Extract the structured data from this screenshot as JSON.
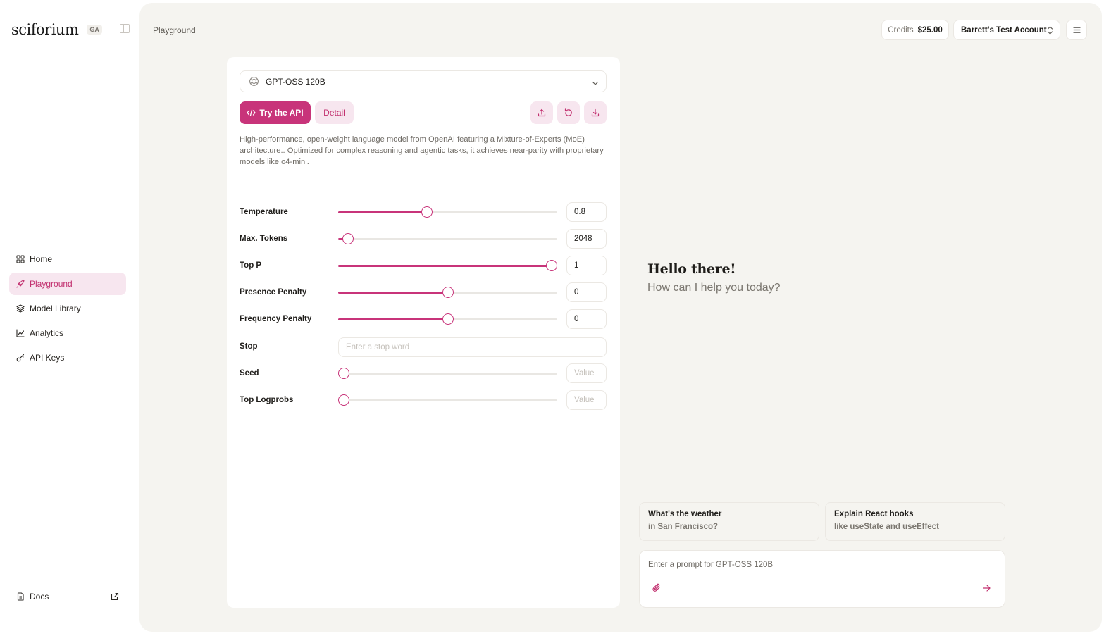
{
  "sidebar": {
    "logo": "sciforium",
    "badge": "GA",
    "items": [
      {
        "label": "Home",
        "icon": "grid-icon"
      },
      {
        "label": "Playground",
        "icon": "rocket-icon",
        "active": true
      },
      {
        "label": "Model Library",
        "icon": "layers-icon"
      },
      {
        "label": "Analytics",
        "icon": "chart-line-icon"
      },
      {
        "label": "API Keys",
        "icon": "key-icon"
      }
    ],
    "docs_label": "Docs"
  },
  "header": {
    "breadcrumb": "Playground",
    "credits_label": "Credits",
    "credits_amount": "$25.00",
    "account_name": "Barrett's Test Account"
  },
  "panel": {
    "model": "GPT-OSS 120B",
    "try_api_label": "Try the API",
    "detail_label": "Detail",
    "description": "High-performance, open-weight language model from OpenAI featuring a Mixture-of-Experts (MoE) architecture.. Optimized for complex reasoning and agentic tasks, it achieves near-parity with proprietary models like o4-mini.",
    "params": {
      "temperature": {
        "label": "Temperature",
        "value": "0.8",
        "fraction": 0.405
      },
      "max_tokens": {
        "label": "Max. Tokens",
        "value": "2048",
        "fraction": 0.045
      },
      "top_p": {
        "label": "Top P",
        "value": "1",
        "fraction": 0.975
      },
      "presence_penalty": {
        "label": "Presence Penalty",
        "value": "0",
        "fraction": 0.5
      },
      "frequency_penalty": {
        "label": "Frequency Penalty",
        "value": "0",
        "fraction": 0.5
      },
      "stop": {
        "label": "Stop",
        "placeholder": "Enter a stop word"
      },
      "seed": {
        "label": "Seed",
        "placeholder": "Value",
        "fraction": 0.025
      },
      "top_logprobs": {
        "label": "Top Logprobs",
        "placeholder": "Value",
        "fraction": 0.025
      }
    }
  },
  "chat": {
    "greeting": "Hello there!",
    "subgreeting": "How can I help you today?",
    "suggestions": [
      {
        "title": "What's the weather",
        "subtitle": "in San Francisco?"
      },
      {
        "title": "Explain React hooks",
        "subtitle": "like useState and useEffect"
      }
    ],
    "prompt_placeholder": "Enter a prompt for GPT-OSS 120B"
  },
  "colors": {
    "accent": "#c8347a",
    "accent_soft": "#f7e6ef",
    "background": "#f5f4f0"
  }
}
